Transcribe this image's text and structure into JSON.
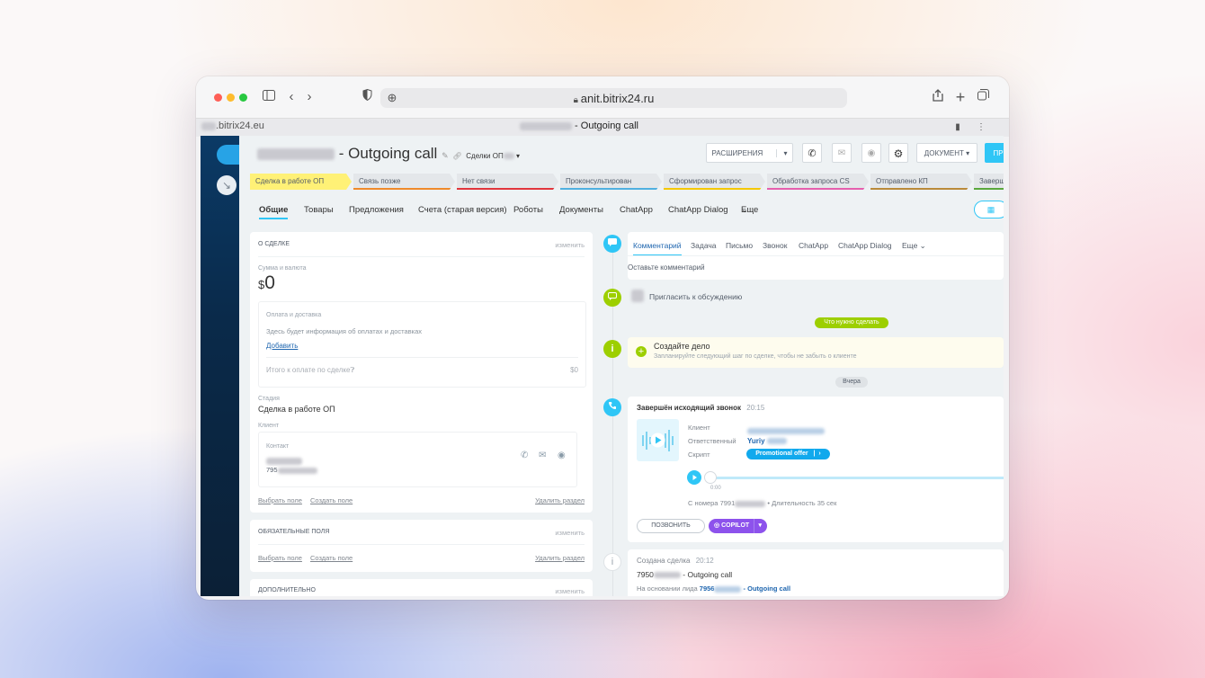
{
  "browser": {
    "url": "anit.bitrix24.ru",
    "tab_left": ".bitrix24.eu",
    "tab_title": "Outgoing call"
  },
  "header": {
    "title": " - Outgoing call",
    "category": "Сделки ОП",
    "btn_extensions": "РАСШИРЕНИЯ",
    "btn_document": "ДОКУМЕНТ",
    "btn_primary": "ПР"
  },
  "stages": [
    {
      "label": "Сделка в работе ОП",
      "color": "#fff176"
    },
    {
      "label": "Связь позже",
      "color": "#e4e7ea"
    },
    {
      "label": "Нет связи",
      "color": "#e4e7ea"
    },
    {
      "label": "Проконсультирован",
      "color": "#e4e7ea"
    },
    {
      "label": "Сформирован запрос",
      "color": "#e4e7ea"
    },
    {
      "label": "Обработка запроса CS",
      "color": "#e4e7ea"
    },
    {
      "label": "Отправлено КП",
      "color": "#e4e7ea"
    },
    {
      "label": "Заверш",
      "color": "#e4e7ea"
    }
  ],
  "tabs": [
    "Общие",
    "Товары",
    "Предложения",
    "Счета (старая версия)",
    "Роботы",
    "Документы",
    "ChatApp",
    "ChatApp Dialog",
    "Еще"
  ],
  "deal": {
    "section_title": "О СДЕЛКЕ",
    "edit": "изменить",
    "sum_label": "Сумма и валюта",
    "currency": "$",
    "amount": "0",
    "payment_title": "Оплата и доставка",
    "payment_info": "Здесь будет информация об оплатах и доставках",
    "add_link": "Добавить",
    "total_label": "Итого к оплате по сделке",
    "total_value": "$0",
    "stage_label": "Стадия",
    "stage_value": "Сделка в работе ОП",
    "client_label": "Клиент",
    "contact_label": "Контакт",
    "contact_phone": "795",
    "choose_field": "Выбрать поле",
    "create_field": "Создать поле",
    "delete_section": "Удалить раздел"
  },
  "required": {
    "title": "ОБЯЗАТЕЛЬНЫЕ ПОЛЯ",
    "edit": "изменить",
    "choose_field": "Выбрать поле",
    "create_field": "Создать поле",
    "delete_section": "Удалить раздел"
  },
  "additional": {
    "title": "ДОПОЛНИТЕЛЬНО",
    "edit": "изменить"
  },
  "timeline": {
    "tabs": [
      "Комментарий",
      "Задача",
      "Письмо",
      "Звонок",
      "ChatApp",
      "ChatApp Dialog",
      "Еще"
    ],
    "comment_placeholder": "Оставьте комментарий",
    "invite": "Пригласить к обсуждению",
    "todo_badge": "Что нужно сделать",
    "create_task_title": "Создайте дело",
    "create_task_hint": "Запланируйте следующий шаг по сделке, чтобы не забыть о клиенте",
    "yesterday_badge": "Вчера",
    "call": {
      "title": "Завершён исходящий звонок",
      "time": "20:15",
      "client_label": "Клиент",
      "responsible_label": "Ответственный",
      "responsible_name": "Yuriy",
      "script_label": "Скрипт",
      "script_value": "Promotional offer",
      "player_time": "0:00",
      "from_number": "С номера 7991",
      "duration": "• Длительность 35 сек",
      "call_button": "ПОЗВОНИТЬ",
      "copilot_button": "COPILOT"
    },
    "created": {
      "title": "Создана сделка",
      "time": "20:12",
      "line1_prefix": "7950",
      "line1_suffix": " - Outgoing call",
      "line2_prefix": "На основании лида ",
      "line2_number": "7956",
      "line2_suffix": " - Outgoing call"
    }
  },
  "colors": {
    "accent": "#2fc6f6",
    "lime": "#9dcf00",
    "blue_icon": "#2fc6f6",
    "copilot": "#8d52ec",
    "script_badge": "#11a9ed"
  }
}
